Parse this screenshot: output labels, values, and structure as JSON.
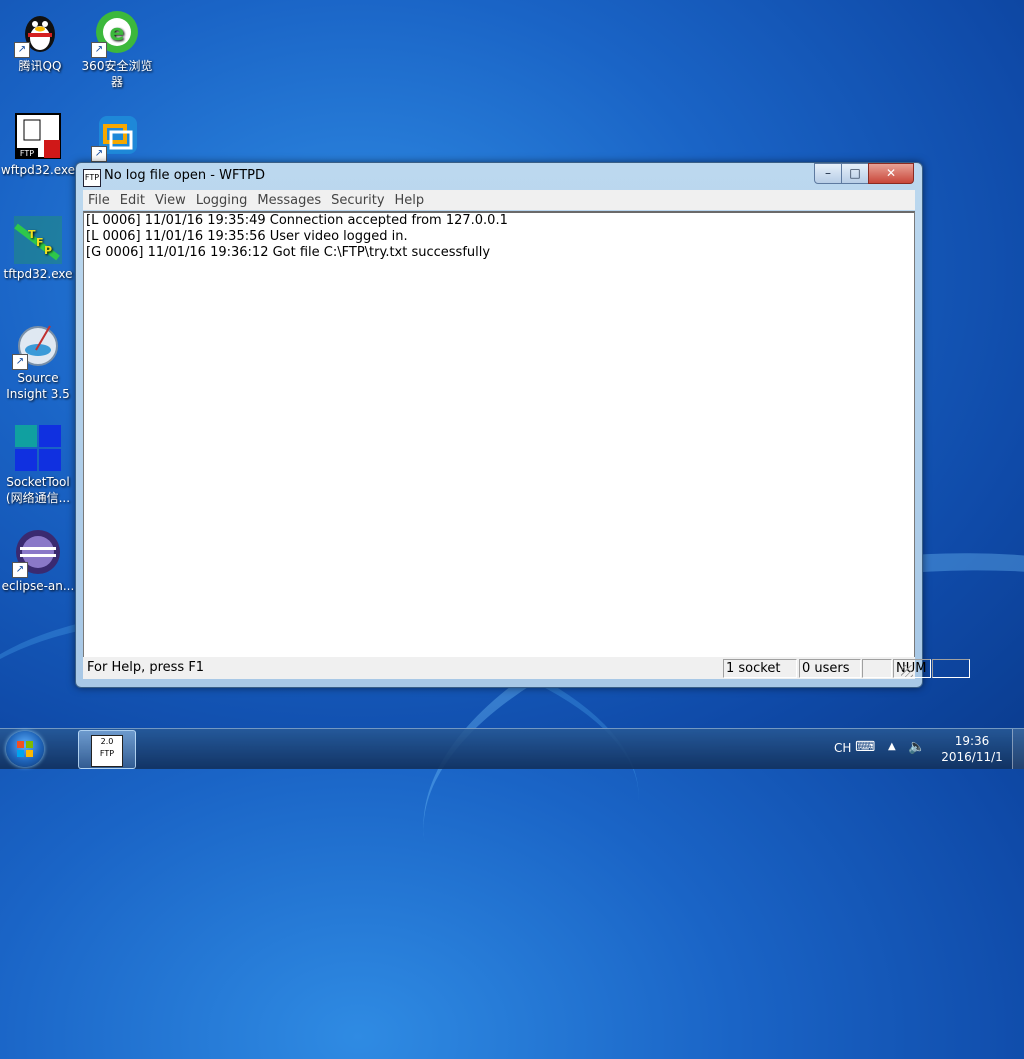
{
  "desktop": {
    "icons": [
      {
        "label_line1": "腾讯QQ",
        "label_line2": ""
      },
      {
        "label_line1": "360安全浏览",
        "label_line2": "器"
      },
      {
        "label_line1": "wftpd32.exe",
        "label_line2": ""
      },
      {
        "label_line1": "",
        "label_line2": ""
      },
      {
        "label_line1": "tftpd32.exe",
        "label_line2": ""
      },
      {
        "label_line1": "Source",
        "label_line2": "Insight 3.5"
      },
      {
        "label_line1": "SocketTool",
        "label_line2": "(网络通信..."
      },
      {
        "label_line1": "eclipse-an...",
        "label_line2": ""
      }
    ]
  },
  "window": {
    "title": "No log file open - WFTPD",
    "menu": [
      "File",
      "Edit",
      "View",
      "Logging",
      "Messages",
      "Security",
      "Help"
    ],
    "log_lines": [
      "[L 0006] 11/01/16 19:35:49 Connection accepted from 127.0.0.1",
      "[L 0006] 11/01/16 19:35:56 User video logged in.",
      "[G 0006] 11/01/16 19:36:12 Got file C:\\FTP\\try.txt successfully"
    ],
    "status": {
      "help": "For Help, press F1",
      "sockets": "1 socket",
      "users": "0 users",
      "blank1": "",
      "num": "NUM",
      "blank2": ""
    },
    "controls": {
      "minimize": "–",
      "maximize": "□",
      "close": "✕"
    }
  },
  "taskbar": {
    "task_icon_label": "FTP",
    "task_icon_version": "2.0",
    "lang": "CH",
    "time": "19:36",
    "date": "2016/11/1"
  }
}
